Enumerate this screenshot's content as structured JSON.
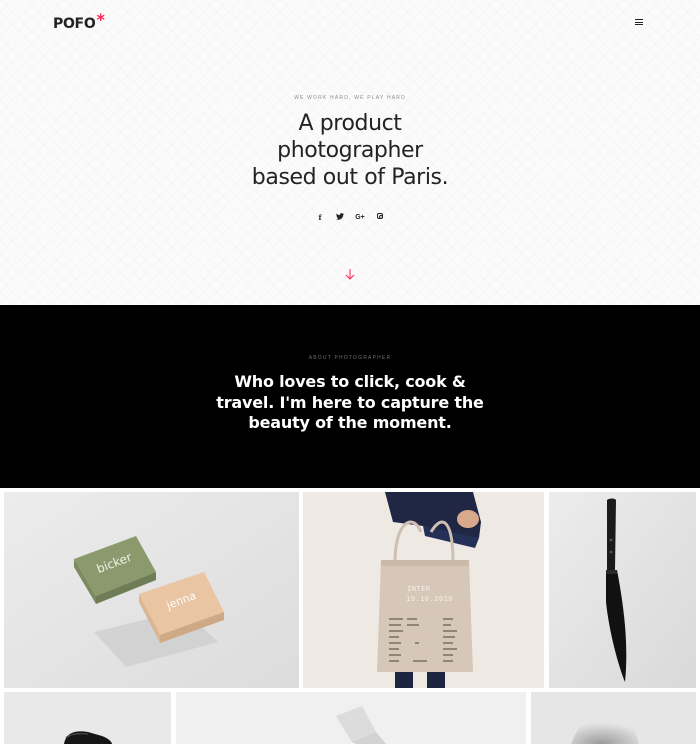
{
  "header": {
    "logo_text": "POFO",
    "logo_mark": "*",
    "menu_icon": "hamburger-icon"
  },
  "hero": {
    "tagline": "WE WORK HARD, WE PLAY HARD",
    "headline_lines": [
      "A product",
      "photographer",
      "based out of Paris."
    ],
    "social": {
      "facebook": "f",
      "twitter": "twitter-icon",
      "googleplus": "G+",
      "instagram": "instagram-icon"
    },
    "scroll_icon": "arrow-down-icon"
  },
  "about": {
    "tag": "ABOUT PHOTOGRAPHER",
    "text_lines": [
      "Who loves to click, cook &",
      "travel. I'm here to capture the",
      "beauty of the moment."
    ]
  },
  "portfolio": {
    "cards": {
      "top": "bicker",
      "bottom": "jenna"
    },
    "bag": {
      "title": "INTER",
      "date": "19.10.2016"
    }
  },
  "colors": {
    "accent": "#ff214f",
    "dark": "#232323",
    "black": "#000000"
  }
}
